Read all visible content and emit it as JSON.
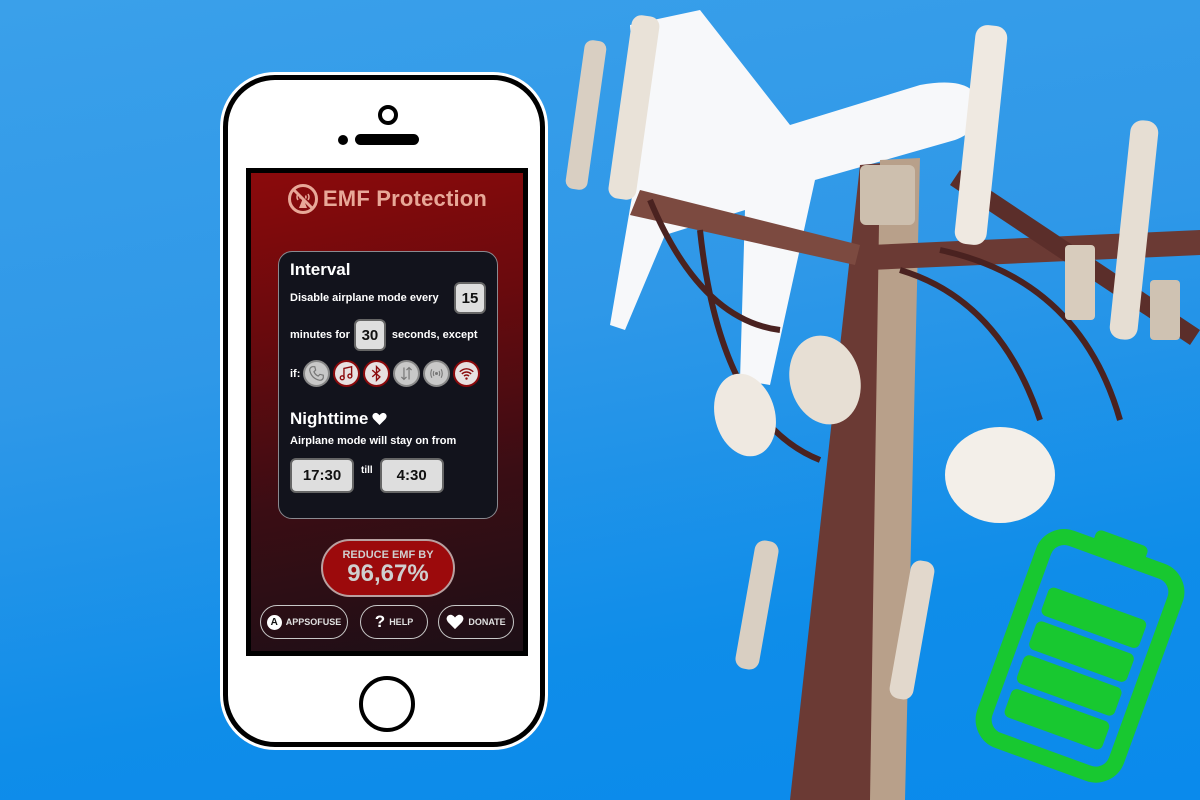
{
  "colors": {
    "background_blue": "#2f98e8",
    "app_red": "#8b0a0c",
    "title_peach": "#e8a898",
    "card_bg": "#12131c",
    "battery_green": "#18c830"
  },
  "app": {
    "title": "EMF Protection",
    "logo_icon": "no-signal-icon"
  },
  "interval": {
    "title": "Interval",
    "text_before_every": "Disable airplane mode every",
    "every_minutes": "15",
    "text_minutes_for": "minutes for",
    "duration_seconds": "30",
    "text_seconds_except": "seconds, except",
    "text_if": "if:",
    "conditions": [
      {
        "name": "phone-call",
        "icon": "phone-icon",
        "enabled": false
      },
      {
        "name": "music",
        "icon": "music-icon",
        "enabled": true
      },
      {
        "name": "bluetooth",
        "icon": "bluetooth-icon",
        "enabled": true
      },
      {
        "name": "data-transfer",
        "icon": "data-transfer-icon",
        "enabled": false
      },
      {
        "name": "hotspot",
        "icon": "hotspot-icon",
        "enabled": false
      },
      {
        "name": "wifi",
        "icon": "wifi-icon",
        "enabled": true
      }
    ]
  },
  "nighttime": {
    "title": "Nighttime",
    "title_icon": "heart-icon",
    "description": "Airplane mode will stay on from",
    "start_time": "17:30",
    "till_label": "till",
    "end_time": "4:30"
  },
  "reduce": {
    "label": "REDUCE EMF BY",
    "value": "96,67%"
  },
  "footer": {
    "appsofuse_label": "APPSOFUSE",
    "appsofuse_icon_letter": "A",
    "help_label": "HELP",
    "help_icon_glyph": "?",
    "donate_label": "DONATE"
  },
  "illustration": {
    "background_elements": [
      "cell-tower",
      "airplane-icon",
      "battery-icon"
    ],
    "battery_level_bars": 4,
    "battery_level_max": 5
  }
}
